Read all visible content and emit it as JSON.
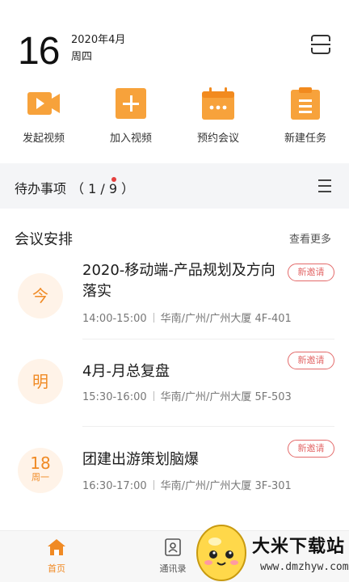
{
  "header": {
    "day": "16",
    "month": "2020年4月",
    "weekday": "周四",
    "scan_icon": "scan-icon"
  },
  "quick_actions": [
    {
      "label": "发起视频",
      "icon": "video-camera-icon"
    },
    {
      "label": "加入视频",
      "icon": "plus-icon"
    },
    {
      "label": "预约会议",
      "icon": "calendar-icon"
    },
    {
      "label": "新建任务",
      "icon": "task-list-icon"
    }
  ],
  "todo": {
    "title": "待办事项",
    "count": "（ 1 / 9 ）",
    "menu_icon": "menu-icon"
  },
  "meetings_section": {
    "title": "会议安排",
    "more": "查看更多"
  },
  "meetings": [
    {
      "day_label": "今",
      "day_sub": "",
      "title": "2020-移动端-产品规划及方向落实",
      "time": "14:00-15:00",
      "location": "华南/广州/广州大厦 4F-401",
      "badge": "新邀请"
    },
    {
      "day_label": "明",
      "day_sub": "",
      "title": "4月-月总复盘",
      "time": "15:30-16:00",
      "location": "华南/广州/广州大厦 5F-503",
      "badge": "新邀请"
    },
    {
      "day_label": "18",
      "day_sub": "周一",
      "title": "团建出游策划脑爆",
      "time": "16:30-17:00",
      "location": "华南/广州/广州大厦 3F-301",
      "badge": "新邀请"
    }
  ],
  "tabbar": {
    "tabs": [
      {
        "label": "首页",
        "icon": "home-icon",
        "active": true
      },
      {
        "label": "通讯录",
        "icon": "contacts-icon",
        "active": false
      }
    ]
  },
  "watermark": {
    "text": "大米下载站",
    "url": "www.dmzhyw.com"
  },
  "colors": {
    "accent": "#f08a24",
    "badge": "#e36a6a",
    "notification_dot": "#e5403e"
  }
}
